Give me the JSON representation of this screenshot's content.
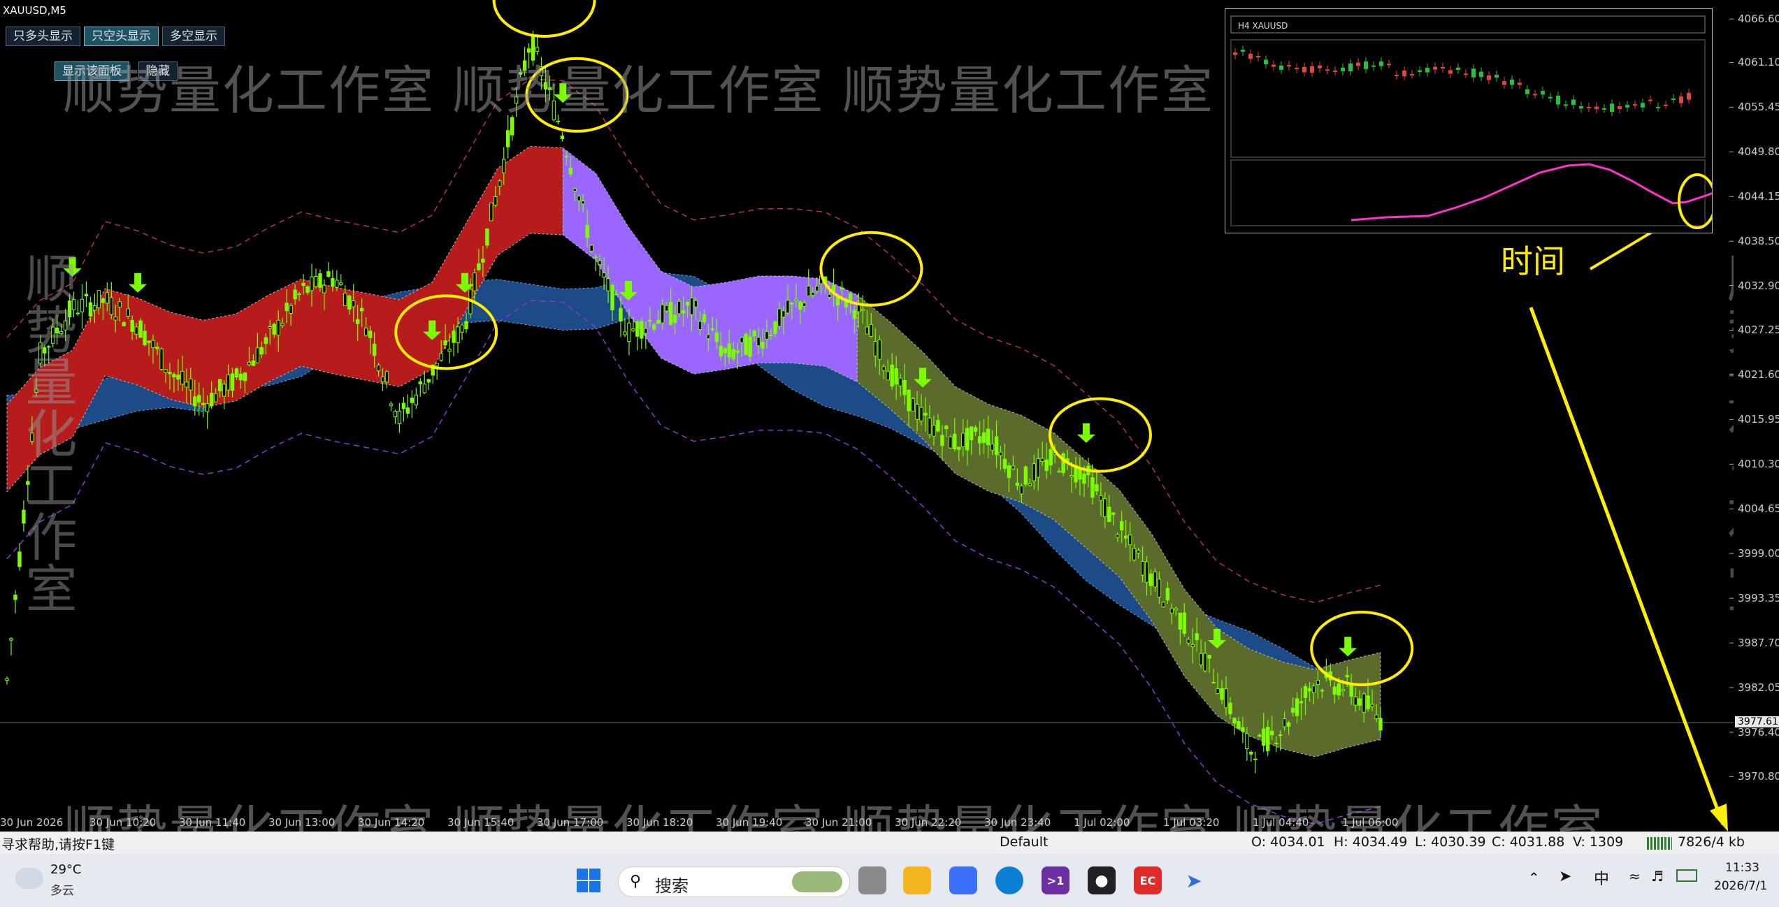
{
  "symbol": "XAUUSD,M5",
  "buttons": [
    "只多头显示",
    "只空头显示",
    "多空显示"
  ],
  "panel_buttons": [
    "显示该面板",
    "隐藏"
  ],
  "watermark": "顺势量化工作室 顺势量化工作室 顺势量化工作室 顺势量化工作室",
  "watermark_vertical": "顺势量化工作室",
  "annotation_label": "时间",
  "inset": {
    "title": "H4  XAUUSD"
  },
  "chart_data": {
    "type": "line",
    "title": "XAUUSD,M5",
    "ylim": [
      3966.5,
      4069
    ],
    "y_ticks": [
      4066.6,
      4061.1,
      4055.45,
      4049.8,
      4044.15,
      4038.5,
      4032.9,
      4027.25,
      4021.6,
      4015.95,
      4010.3,
      4004.65,
      3999.0,
      3993.35,
      3987.7,
      3982.05,
      3976.4,
      3970.8
    ],
    "y_tick_labels": [
      "4066.60",
      "4061.10",
      "4055.45",
      "4049.80",
      "4044.15",
      "4038.50",
      "4032.90",
      "4027.25",
      "4021.60",
      "4015.95",
      "4010.30",
      "4004.65",
      "3999.00",
      "3993.35",
      "3987.70",
      "3982.05",
      "3976.40",
      "3970.80"
    ],
    "current_price": "3977.61",
    "x_tick_labels": [
      "30 Jun 2026",
      "30 Jun 10:20",
      "30 Jun 11:40",
      "30 Jun 13:00",
      "30 Jun 14:20",
      "30 Jun 15:40",
      "30 Jun 17:00",
      "30 Jun 18:20",
      "30 Jun 19:40",
      "30 Jun 21:00",
      "30 Jun 22:20",
      "30 Jun 23:40",
      "1 Jul 02:00",
      "1 Jul 03:20",
      "1 Jul 04:40",
      "1 Jul 06:00"
    ],
    "series": [
      {
        "values": [
          3983,
          4024,
          4030,
          4031,
          4028,
          4022,
          4018,
          4021,
          4026,
          4032,
          4034,
          4028,
          4016,
          4022,
          4028,
          4045,
          4064,
          4052,
          4036,
          4027,
          4029,
          4030,
          4024,
          4026,
          4030,
          4033,
          4030,
          4022,
          4016,
          4013,
          4014,
          4008,
          4011,
          4009,
          4002,
          3996,
          3990,
          3983,
          3974,
          3977,
          3983,
          3982,
          3978
        ]
      }
    ],
    "bands": [
      {
        "color": "#b71c1c",
        "label": ""
      },
      {
        "color": "#9966ff",
        "label": ""
      },
      {
        "color": "#5b6b2c",
        "label": ""
      },
      {
        "color": "#1f4f8f",
        "label": ""
      }
    ],
    "arrow_signals": 11,
    "grid": false
  },
  "status": {
    "help": "寻求帮助,请按F1键",
    "profile": "Default",
    "open": "O: 4034.01",
    "high": "H: 4034.49",
    "low": "L: 4030.39",
    "close": "C: 4031.88",
    "volume": "V: 1309",
    "traffic": "7826/4 kb"
  },
  "taskbar": {
    "temperature": "29°C",
    "weather": "多云",
    "search_placeholder": "搜索",
    "ime": "中",
    "time": "11:33",
    "date": "2026/7/1"
  },
  "colors": {
    "bear_band": "#b71c1c",
    "bull_band": "#1f4f8f",
    "purple_band": "#9966ff",
    "olive_band": "#5b6b2c",
    "candle": "#7cfc00",
    "highlight": "#ffee00"
  }
}
